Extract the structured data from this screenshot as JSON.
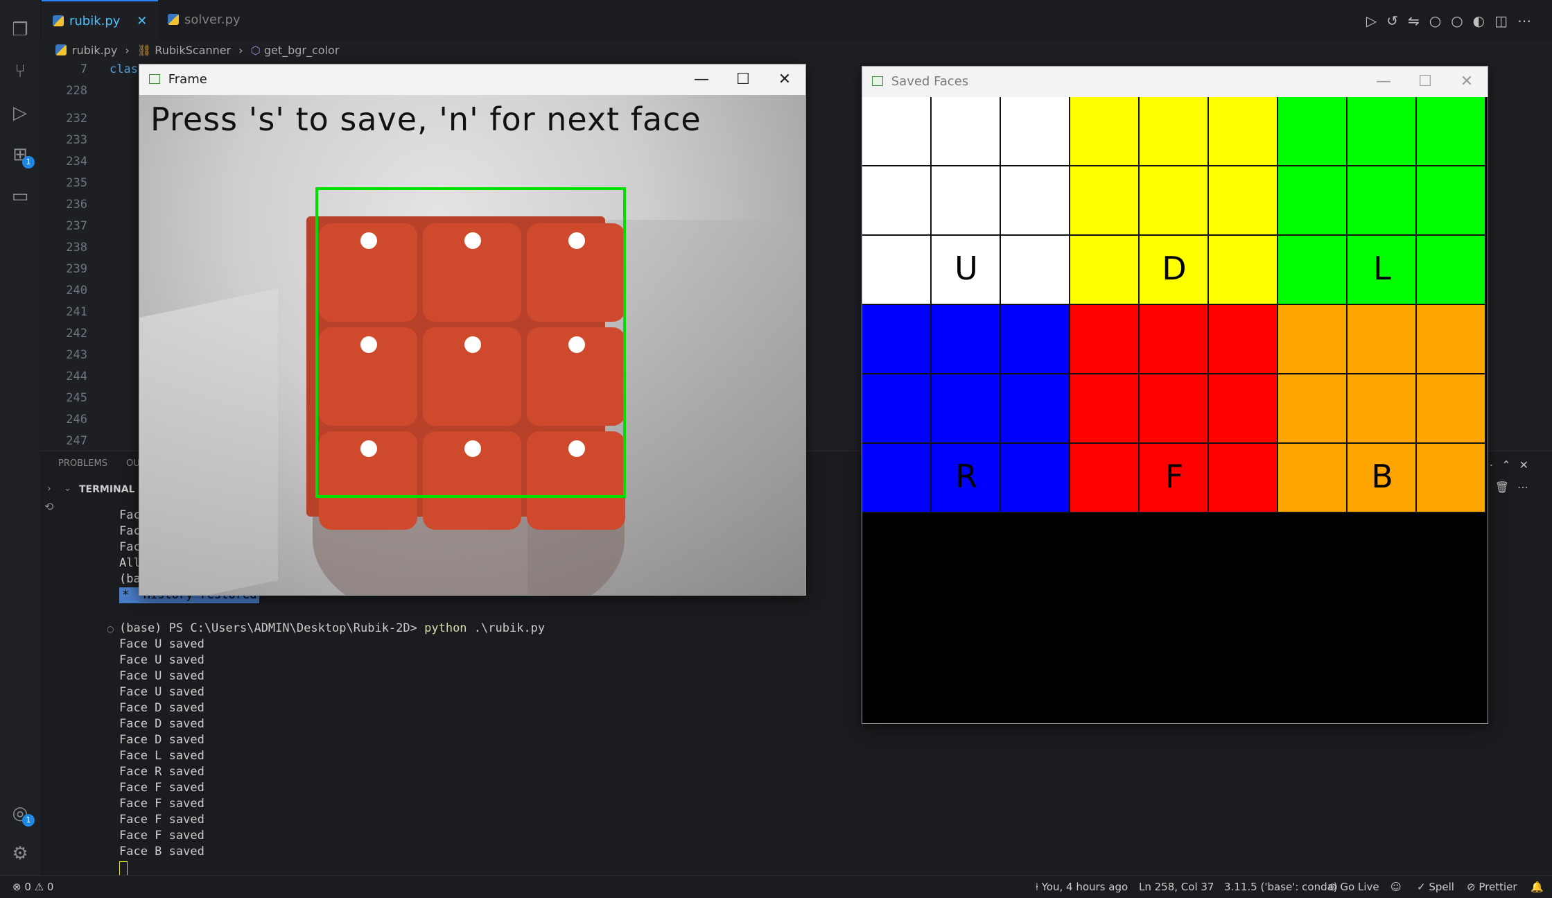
{
  "editor": {
    "tabs": [
      {
        "label": "rubik.py",
        "close": "✕"
      },
      {
        "label": "solver.py"
      }
    ],
    "breadcrumb": [
      "rubik.py",
      "RubikScanner",
      "get_bgr_color"
    ],
    "line_numbers": [
      "7",
      "228",
      "232",
      "233",
      "234",
      "235",
      "236",
      "237",
      "238",
      "239",
      "240",
      "241",
      "242",
      "243",
      "244",
      "245",
      "246",
      "247"
    ],
    "code_fragment": "clas"
  },
  "panel": {
    "tabs": [
      "PROBLEMS",
      "OU",
      "TERMINAL"
    ],
    "terminal_lines_old": [
      "Face F sa",
      "Face B sa",
      "Face B sa",
      "All faces",
      "(base) PS"
    ],
    "history_restored": "*  History restored",
    "prompt": "(base) PS C:\\Users\\ADMIN\\Desktop\\Rubik-2D>",
    "command": "python",
    "command_arg": ".\\rubik.py",
    "terminal_lines": [
      "Face U saved",
      "Face U saved",
      "Face U saved",
      "Face U saved",
      "Face D saved",
      "Face D saved",
      "Face D saved",
      "Face L saved",
      "Face R saved",
      "Face F saved",
      "Face F saved",
      "Face F saved",
      "Face F saved",
      "Face B saved"
    ]
  },
  "status_bar": {
    "errors": "0",
    "warnings": "0",
    "blame": "You, 4 hours ago",
    "cursor": "Ln 258, Col 37",
    "interpreter": "3.11.5 ('base': conda)",
    "go_live": "Go Live",
    "spell": "Spell",
    "prettier": "Prettier"
  },
  "frame_window": {
    "title": "Frame",
    "overlay_text": "Press 's' to save, 'n' for next face",
    "colors": {
      "sticker": "#cf4a2c",
      "box": "#00ff00",
      "dot": "#ffffff"
    }
  },
  "faces_window": {
    "title": "Saved Faces",
    "faces": [
      {
        "label": "U",
        "color": "#ffffff"
      },
      {
        "label": "D",
        "color": "#ffff00"
      },
      {
        "label": "L",
        "color": "#00ff00"
      },
      {
        "label": "R",
        "color": "#0000ff"
      },
      {
        "label": "F",
        "color": "#ff0000"
      },
      {
        "label": "B",
        "color": "#ffa500"
      }
    ]
  }
}
